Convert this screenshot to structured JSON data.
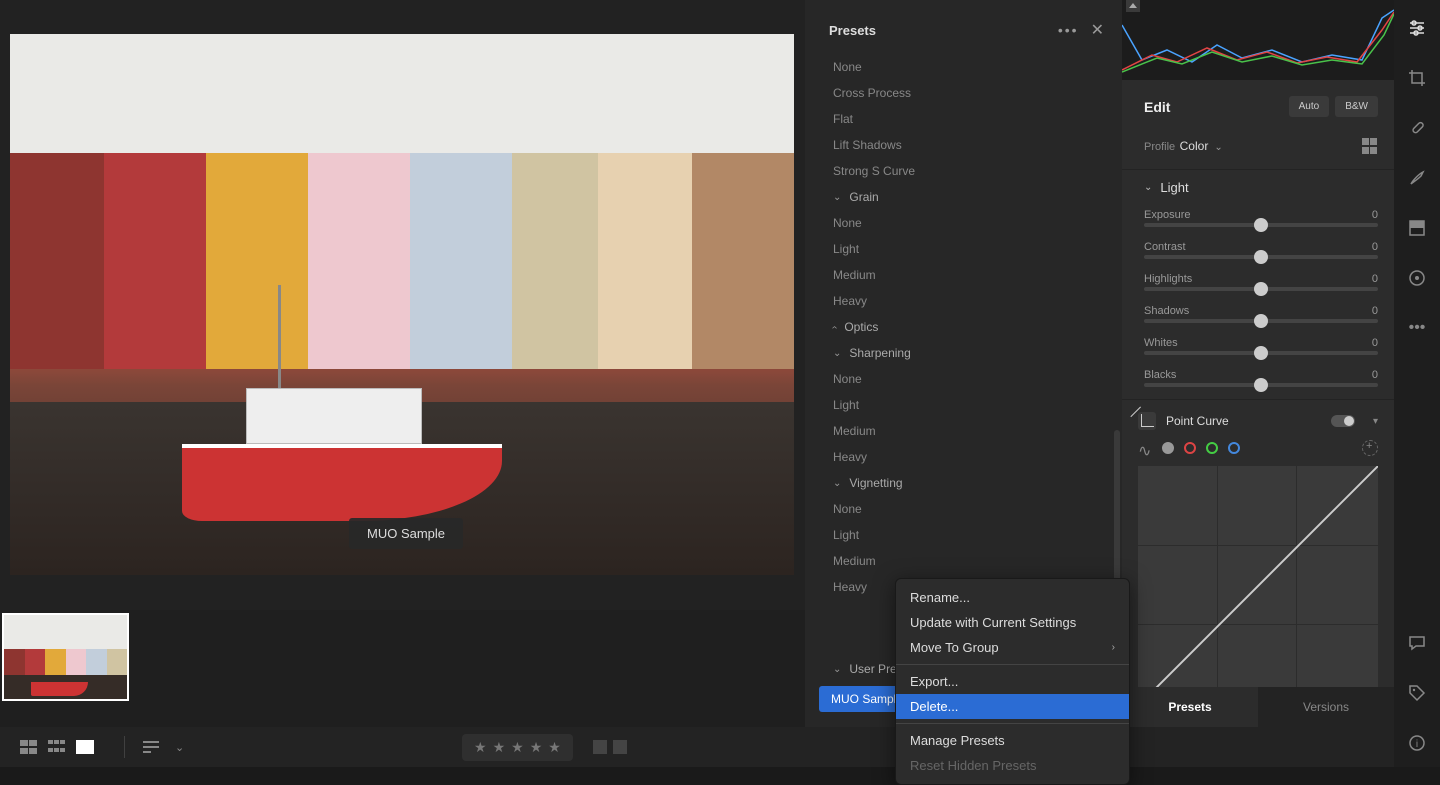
{
  "overlay_label": "MUO Sample",
  "presets_panel": {
    "title": "Presets",
    "items_top": [
      "None",
      "Cross Process",
      "Flat",
      "Lift Shadows",
      "Strong S Curve"
    ],
    "groups": [
      {
        "name": "Grain",
        "expanded": true,
        "closed": false,
        "items": [
          "None",
          "Light",
          "Medium",
          "Heavy"
        ]
      },
      {
        "name": "Optics",
        "expanded": false,
        "closed": true,
        "items": []
      },
      {
        "name": "Sharpening",
        "expanded": true,
        "closed": false,
        "items": [
          "None",
          "Light",
          "Medium",
          "Heavy"
        ]
      },
      {
        "name": "Vignetting",
        "expanded": true,
        "closed": false,
        "items": [
          "None",
          "Light",
          "Medium",
          "Heavy"
        ]
      }
    ],
    "user_group": "User Presets",
    "selected_preset": "MUO Sampl"
  },
  "context_menu": {
    "rename": "Rename...",
    "update": "Update with Current Settings",
    "move": "Move To Group",
    "export": "Export...",
    "delete": "Delete...",
    "manage": "Manage Presets",
    "reset": "Reset Hidden Presets"
  },
  "edit_panel": {
    "title": "Edit",
    "auto": "Auto",
    "bw": "B&W",
    "profile_label": "Profile",
    "profile_value": "Color",
    "light_section": "Light",
    "sliders": [
      {
        "label": "Exposure",
        "value": "0"
      },
      {
        "label": "Contrast",
        "value": "0"
      },
      {
        "label": "Highlights",
        "value": "0"
      },
      {
        "label": "Shadows",
        "value": "0"
      },
      {
        "label": "Whites",
        "value": "0"
      },
      {
        "label": "Blacks",
        "value": "0"
      }
    ],
    "point_curve": "Point Curve",
    "channels": [
      "#999",
      "#d44",
      "#4c4",
      "#48d"
    ]
  },
  "bottom_tabs": {
    "presets": "Presets",
    "versions": "Versions"
  }
}
